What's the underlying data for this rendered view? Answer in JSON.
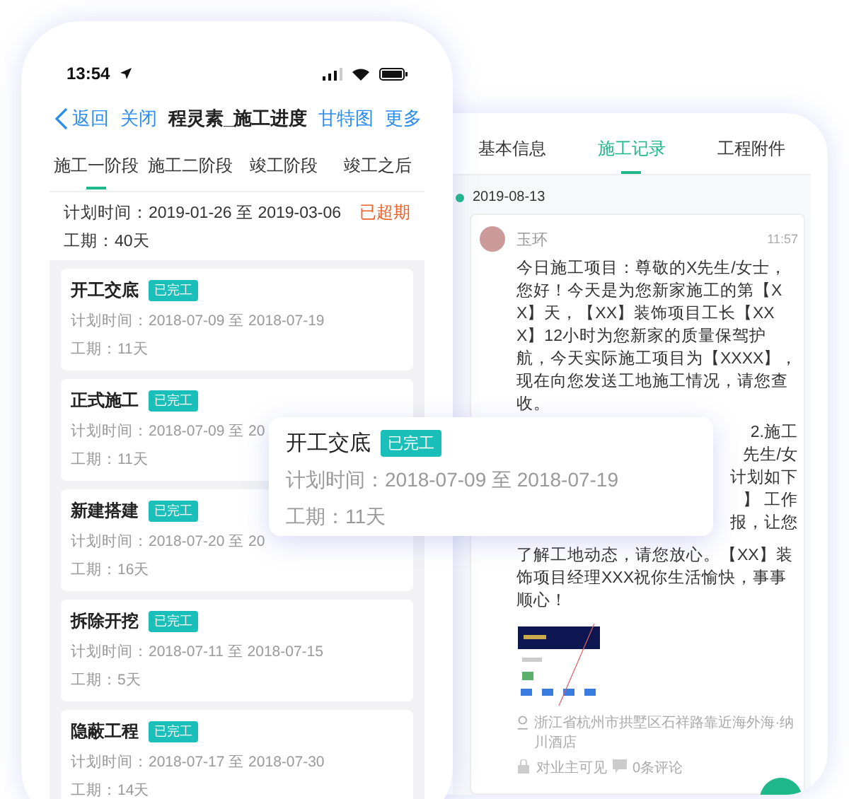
{
  "left_phone": {
    "status_bar": {
      "time": "13:54"
    },
    "nav": {
      "back": "返回",
      "close": "关闭",
      "title": "程灵素_施工进度",
      "actions": [
        "甘特图",
        "更多"
      ]
    },
    "tabs": [
      {
        "label": "施工一阶段",
        "selected": true
      },
      {
        "label": "施工二阶段",
        "selected": false
      },
      {
        "label": "竣工阶段",
        "selected": false
      },
      {
        "label": "竣工之后",
        "selected": false
      }
    ],
    "summary": {
      "plan": "计划时间：2019-01-26 至 2019-03-06",
      "status": "已超期",
      "duration": "工期：40天"
    },
    "tasks": [
      {
        "name": "开工交底",
        "status": "已完工",
        "plan": "计划时间：2018-07-09 至 2018-07-19",
        "duration": "工期：11天"
      },
      {
        "name": "正式施工",
        "status": "已完工",
        "plan": "计划时间：2018-07-09 至 20",
        "duration": "工期：11天"
      },
      {
        "name": "新建搭建",
        "status": "已完工",
        "plan": "计划时间：2018-07-20 至 20",
        "duration": "工期：16天"
      },
      {
        "name": "拆除开挖",
        "status": "已完工",
        "plan": "计划时间：2018-07-11 至 2018-07-15",
        "duration": "工期：5天"
      },
      {
        "name": "隐蔽工程",
        "status": "已完工",
        "plan": "计划时间：2018-07-17 至 2018-07-30",
        "duration": "工期：14天"
      }
    ]
  },
  "right_phone": {
    "tabs": [
      {
        "label": "基本信息",
        "selected": false
      },
      {
        "label": "施工记录",
        "selected": true
      },
      {
        "label": "工程附件",
        "selected": false
      }
    ],
    "date": "2019-08-13",
    "record": {
      "author": "玉环",
      "time": "11:57",
      "text_top": "今日施工项目：尊敬的X先生/女士，您好！今天是为您新家施工的第【XX】天，【XX】装饰项目工长【XXX】12小时为您新家的质量保驾护航，今天实际施工项目为【XXXX】，现在向您发送工地施工情况，请您查收。",
      "fragments": [
        "2.施工",
        "先生/女",
        "计划如下",
        "】 工作",
        "报，让您"
      ],
      "text_bottom": "了解工地动态，请您放心。【XX】装饰项目经理XXX祝你生活愉快，事事顺心！",
      "location": "浙江省杭州市拱墅区石祥路靠近海外海·纳川酒店",
      "visibility": "对业主可见",
      "comments": "0条评论"
    }
  },
  "popup_card": {
    "name": "开工交底",
    "status": "已完工",
    "plan": "计划时间：2018-07-09 至 2018-07-19",
    "duration": "工期：11天"
  }
}
